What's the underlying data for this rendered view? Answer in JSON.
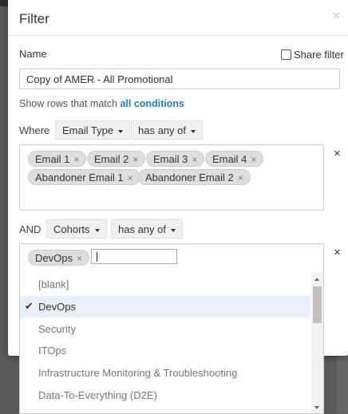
{
  "modal": {
    "title": "Filter",
    "close_icon": "×",
    "name_label": "Name",
    "share_label": "Share filter",
    "name_value": "Copy of AMER - All Promotional",
    "match_prefix": "Show rows that match ",
    "match_link": "all conditions"
  },
  "conditions": [
    {
      "label": "Where",
      "field": "Email Type",
      "operator": "has any of",
      "tags": [
        "Email 1",
        "Email 2",
        "Email 3",
        "Email 4",
        "Abandoner Email 1",
        "Abandoner Email 2"
      ],
      "remove": "×"
    },
    {
      "label": "AND",
      "field": "Cohorts",
      "operator": "has any of",
      "tags": [
        "DevOps"
      ],
      "remove": "×"
    }
  ],
  "tag_remove": "×",
  "check_mark": "✔",
  "dropdown": {
    "options": [
      "[blank]",
      "DevOps",
      "Security",
      "ITOps",
      "Infrastructure Monitoring & Troubleshooting",
      "Data-To-Everything (D2E)"
    ],
    "selected": "DevOps"
  }
}
